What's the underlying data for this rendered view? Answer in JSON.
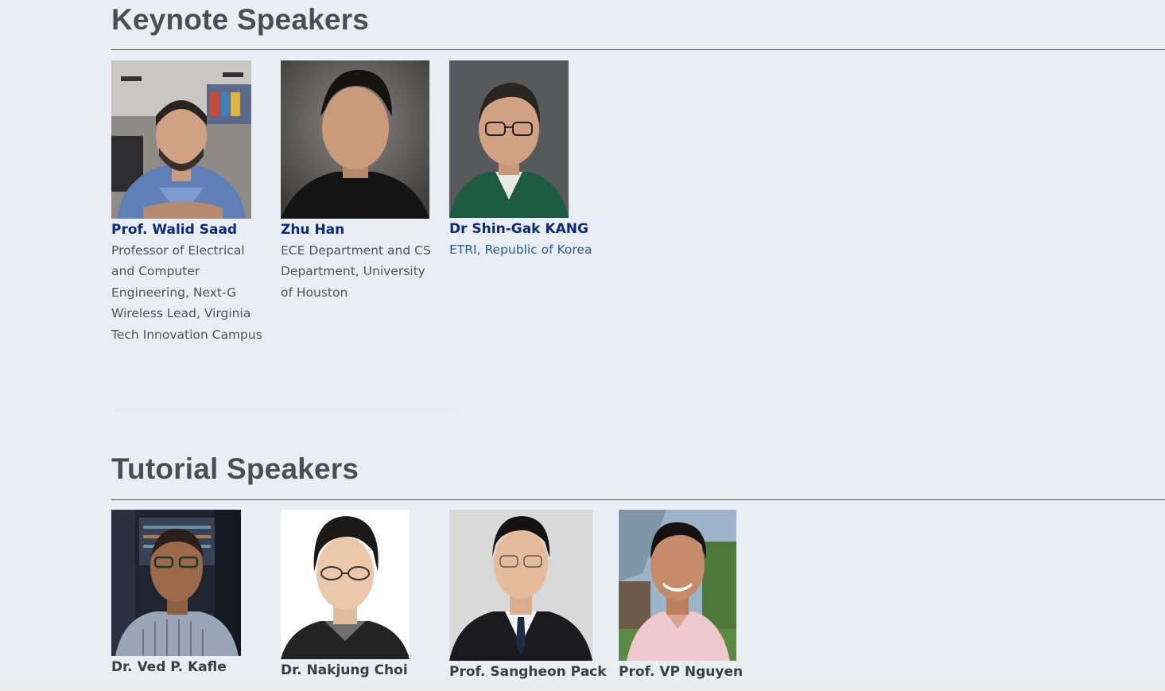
{
  "keynote": {
    "title": "Keynote Speakers",
    "speakers": [
      {
        "name": "Prof. Walid Saad",
        "affiliation": "Professor of Electrical and Computer Engineering, Next-G Wireless Lead, Virginia Tech Innovation Campus"
      },
      {
        "name": "Zhu Han",
        "affiliation": "ECE Department and CS Department, University of Houston"
      },
      {
        "name": "Dr Shin-Gak KANG",
        "affiliation": "ETRI, Republic of Korea"
      }
    ]
  },
  "tutorial": {
    "title": "Tutorial Speakers",
    "speakers": [
      {
        "name": "Dr. Ved P. Kafle"
      },
      {
        "name": "Dr. Nakjung Choi"
      },
      {
        "name": "Prof. Sangheon Pack"
      },
      {
        "name": "Prof. VP Nguyen"
      }
    ]
  },
  "colors": {
    "background": "#e9edf4",
    "heading": "#4a4f55",
    "keynote_name": "#0b2a78",
    "link": "#2d5e93",
    "body_text": "#4d545b"
  }
}
